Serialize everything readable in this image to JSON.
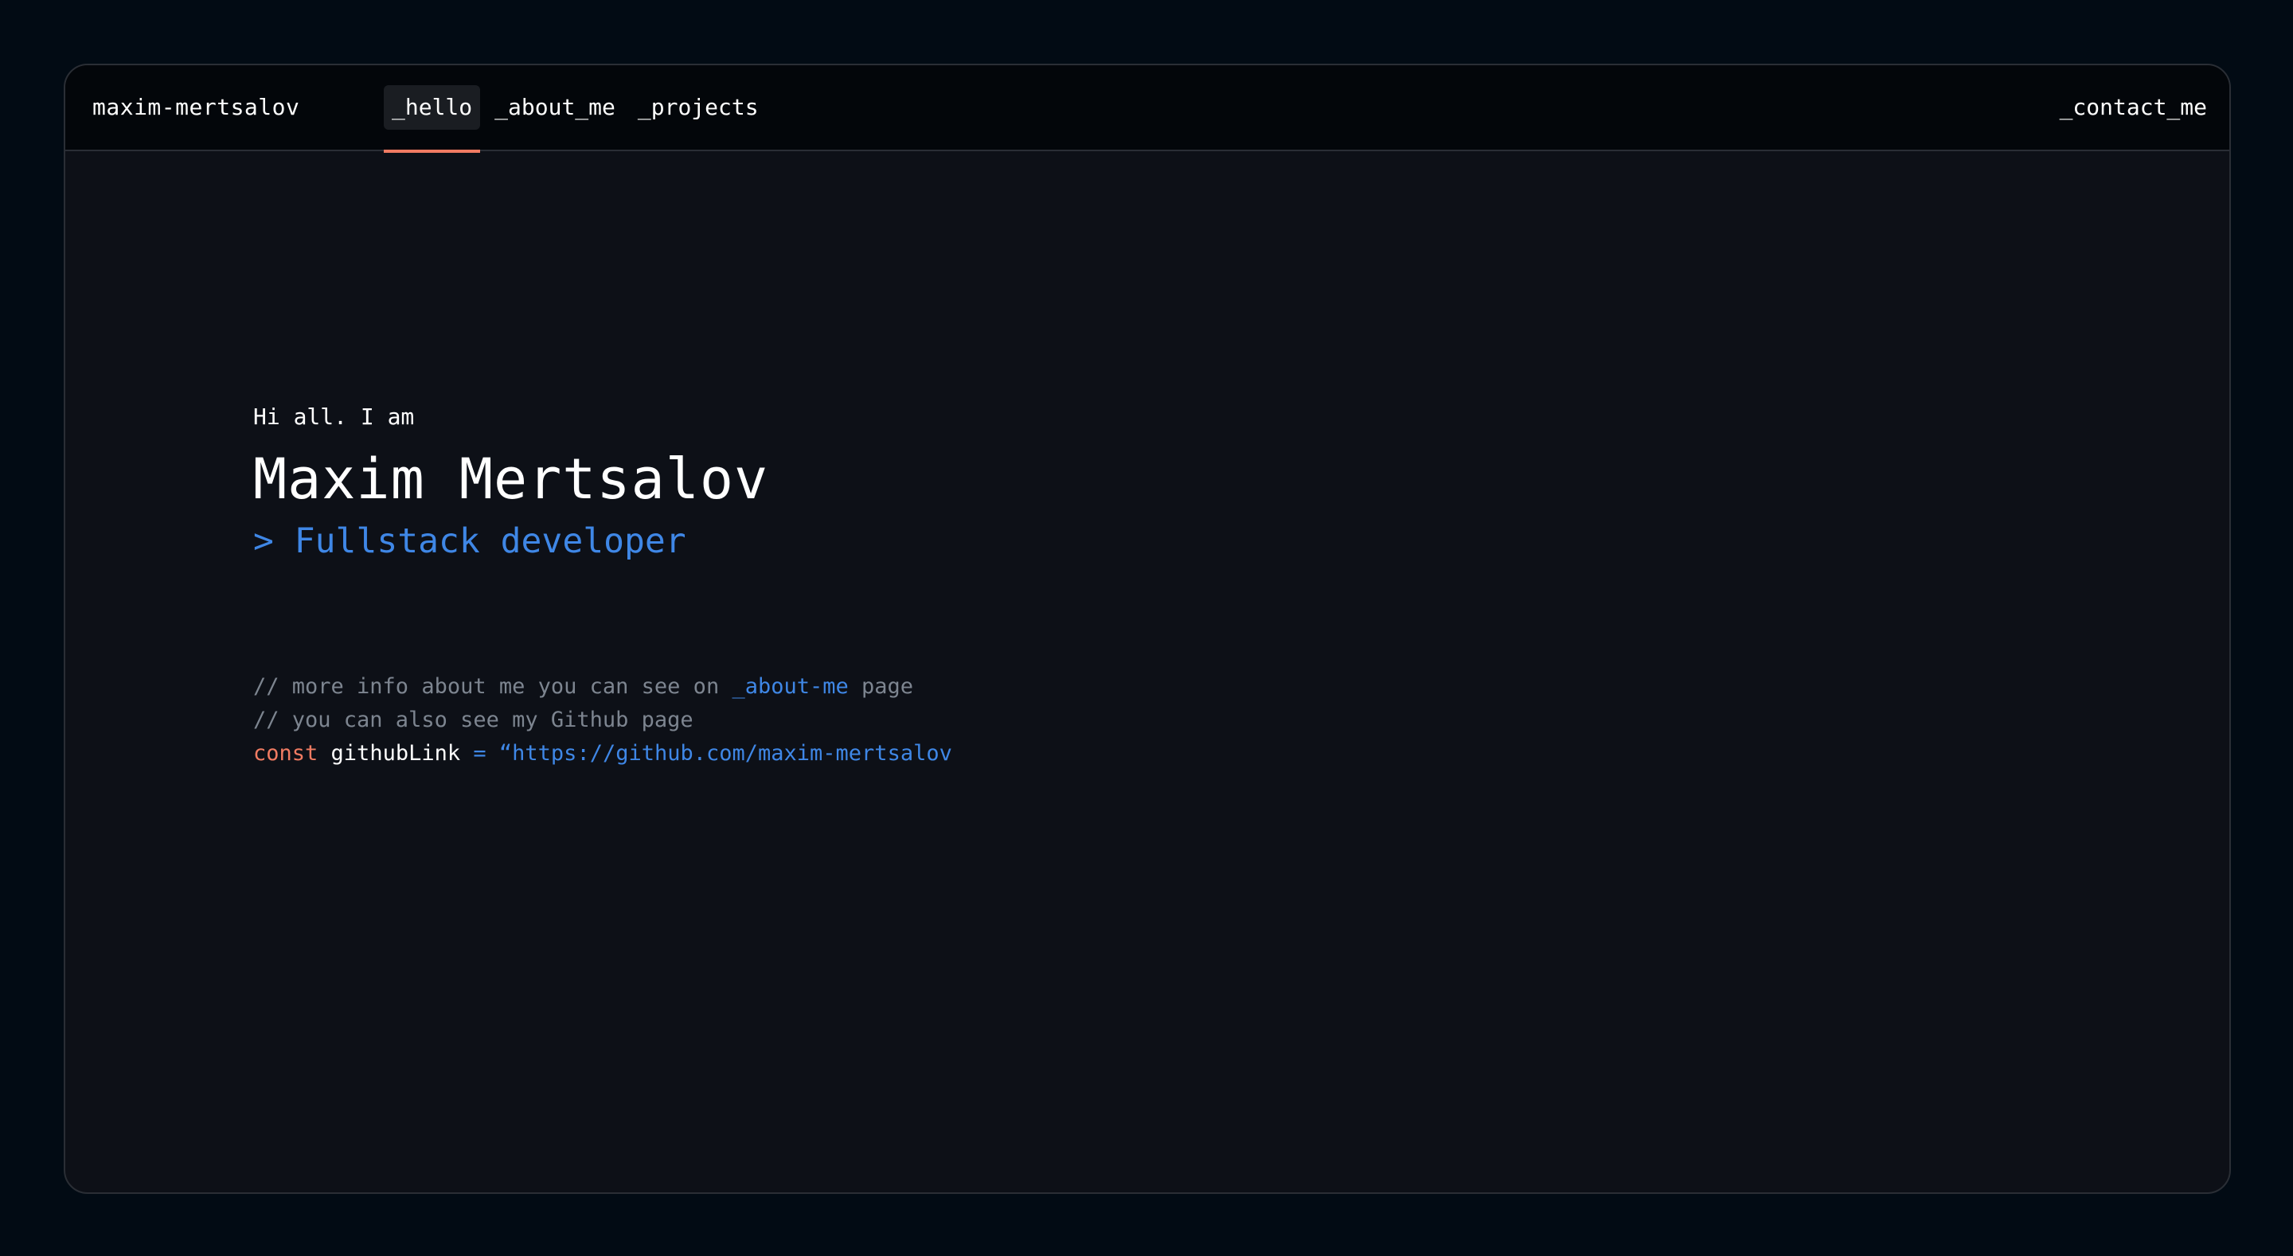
{
  "header": {
    "brand": "maxim-mertsalov",
    "tabs": [
      {
        "label": "_hello",
        "active": true
      },
      {
        "label": "_about_me",
        "active": false
      },
      {
        "label": "_projects",
        "active": false
      }
    ],
    "contact_label": "_contact_me"
  },
  "hero": {
    "greeting": "Hi all. I am",
    "name": "Maxim Mertsalov",
    "role": "> Fullstack developer"
  },
  "code": {
    "line1_prefix": "// more info about me you can see on ",
    "line1_link": "_about-me",
    "line1_suffix": " page",
    "line2": "// you can also see my Github page",
    "line3_keyword": "const",
    "line3_ident": "githubLink",
    "line3_op": "=",
    "line3_string": "“https://github.com/maxim-mertsalov"
  },
  "colors": {
    "background": "#020b14",
    "panel": "#0d1017",
    "header": "#03060a",
    "accent": "#f07b62",
    "link": "#3f87e6",
    "comment": "#7d8590"
  }
}
